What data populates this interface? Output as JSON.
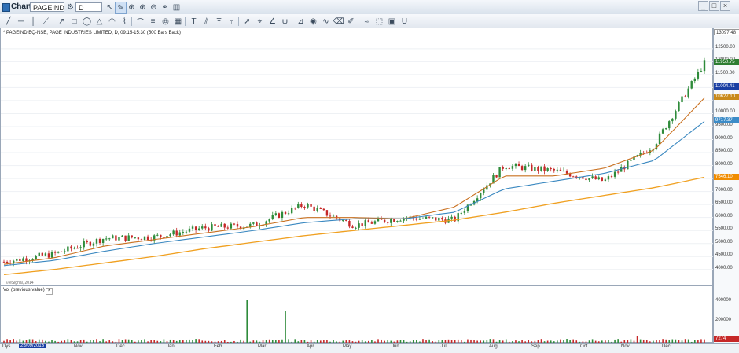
{
  "window": {
    "title": "Chart",
    "symbol": "PAGEIND E",
    "interval": "D"
  },
  "toolbar": {
    "icons": [
      "gear-icon",
      "add-icon",
      "remove-icon",
      "arrow-icon",
      "pencil-icon",
      "crosshair-icon",
      "zoom-in-icon",
      "zoom-out-icon",
      "link-icon",
      "bars-icon",
      "line-tool-icon",
      "hline-icon",
      "vline-icon",
      "ray-icon",
      "trend-icon",
      "rectangle-icon",
      "ellipse-icon",
      "triangle-icon",
      "arc-icon",
      "polyline-icon",
      "brush-icon",
      "fib-icon",
      "circle-icon",
      "grid-icon",
      "text-icon",
      "channel-icon",
      "text-tool-icon",
      "fork-icon",
      "arrow-tool-icon",
      "target-icon",
      "angle-icon",
      "pitchfork-icon",
      "gann-icon",
      "eye-icon",
      "cycle-icon",
      "eraser-icon",
      "pen-icon",
      "wave-icon",
      "select-icon",
      "save-icon",
      "unlock-icon"
    ]
  },
  "chart": {
    "legend": "* PAGEIND.EQ-NSE, PAGE INDUSTRIES LIMITED, D, 09:15-15:30 (500 Bars Back)",
    "esignal": "© eSignal, 2014",
    "price_ticks": [
      "12500.00",
      "12000.00",
      "11500.00",
      "11000.00",
      "10500.00",
      "10000.00",
      "9500.00",
      "9000.00",
      "8500.00",
      "8000.00",
      "7500.00",
      "7000.00",
      "6500.00",
      "6000.00",
      "5500.00",
      "5000.00",
      "4500.00",
      "4000.00"
    ],
    "tags": [
      {
        "label": "13097.48",
        "color": "#ffffff",
        "text": "#333333"
      },
      {
        "label": "11950.75",
        "color": "#2e7d32",
        "text": "#ffffff"
      },
      {
        "label": "11004.41",
        "color": "#1a3fa3",
        "text": "#ffffff"
      },
      {
        "label": "10627.10",
        "color": "#c98a1b",
        "text": "#ffffff"
      },
      {
        "label": "9717.37",
        "color": "#3c8cc8",
        "text": "#ffffff"
      },
      {
        "label": "7546.10",
        "color": "#f08c00",
        "text": "#ffffff"
      }
    ],
    "colors": {
      "up": "#2e8b3a",
      "down": "#c62828",
      "ema_fast": "#c9701f",
      "ema_mid": "#3a88c0",
      "ema_slow": "#f0a020",
      "dotted": "#9a3a6a"
    }
  },
  "volume": {
    "label": "Vol (previous value)",
    "close": "×",
    "ticks": [
      "400000",
      "200000"
    ],
    "tag": "7274"
  },
  "dates": {
    "first_label": "Dys",
    "current": "25/09/2013",
    "months": [
      "Nov",
      "Dec",
      "Jan",
      "Feb",
      "Mar",
      "Apr",
      "May",
      "Jun",
      "Jul",
      "Aug",
      "Sep",
      "Oct",
      "Nov",
      "Dec"
    ]
  },
  "chart_data": {
    "type": "line",
    "title": "* PAGEIND.EQ-NSE, PAGE INDUSTRIES LIMITED, D, 09:15-15:30 (500 Bars Back)",
    "xlabel": "",
    "ylabel": "",
    "ylim": [
      3600,
      13100
    ],
    "x": [
      "Oct",
      "Nov",
      "Dec",
      "Jan",
      "Feb",
      "Mar",
      "Apr",
      "May",
      "Jun",
      "Jul",
      "Aug",
      "Sep",
      "Oct",
      "Nov",
      "Dec"
    ],
    "series": [
      {
        "values": [
          4300,
          4600,
          5200,
          5250,
          5600,
          5700,
          6500,
          5700,
          6000,
          5900,
          8000,
          7800,
          7400,
          8800,
          11950
        ]
      },
      {
        "values": [
          4200,
          4450,
          4900,
          5150,
          5400,
          5650,
          6000,
          6000,
          5950,
          6400,
          7600,
          7600,
          7900,
          8600,
          10600
        ]
      },
      {
        "values": [
          4150,
          4350,
          4700,
          5000,
          5250,
          5500,
          5800,
          5950,
          5950,
          6200,
          7100,
          7400,
          7700,
          8200,
          9700
        ]
      },
      {
        "values": [
          3800,
          4000,
          4250,
          4500,
          4800,
          5050,
          5300,
          5500,
          5700,
          5900,
          6200,
          6550,
          6850,
          7150,
          7550
        ]
      }
    ]
  }
}
